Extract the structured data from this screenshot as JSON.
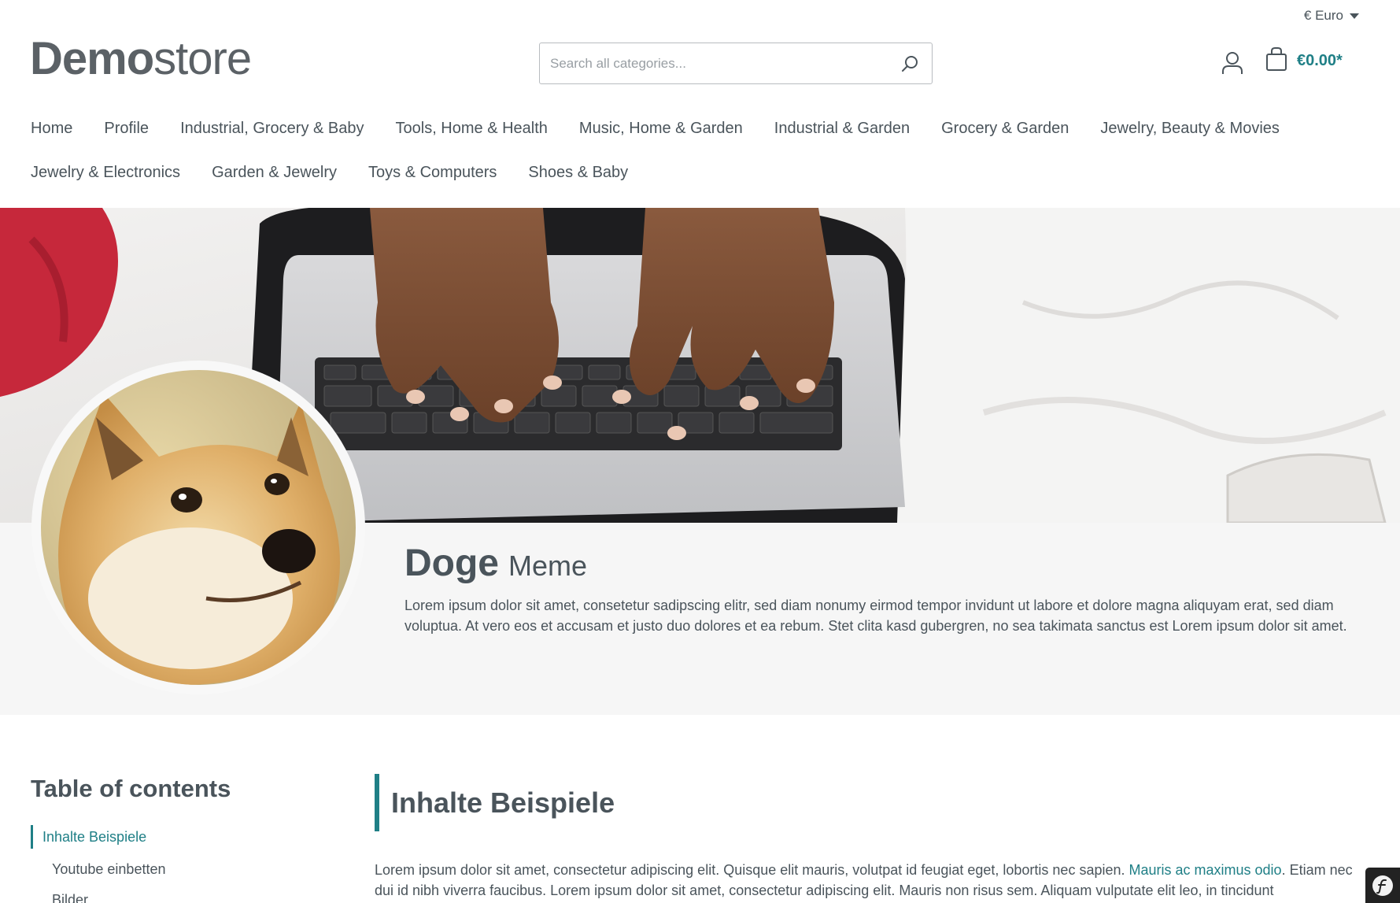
{
  "header": {
    "currency": "€ Euro",
    "logo_bold": "Demo",
    "logo_light": "store",
    "search_placeholder": "Search all categories...",
    "cart_total": "€0.00*"
  },
  "nav": {
    "items": [
      "Home",
      "Profile",
      "Industrial, Grocery & Baby",
      "Tools, Home & Health",
      "Music, Home & Garden",
      "Industrial & Garden",
      "Grocery & Garden",
      "Jewelry, Beauty & Movies",
      "Jewelry & Electronics",
      "Garden & Jewelry",
      "Toys & Computers",
      "Shoes & Baby"
    ]
  },
  "profile": {
    "first_name": "Doge",
    "last_name": "Meme",
    "description": "Lorem ipsum dolor sit amet, consetetur sadipscing elitr, sed diam nonumy eirmod tempor invidunt ut labore et dolore magna aliquyam erat, sed diam voluptua. At vero eos et accusam et justo duo dolores et ea rebum. Stet clita kasd gubergren, no sea takimata sanctus est Lorem ipsum dolor sit amet."
  },
  "toc": {
    "title": "Table of contents",
    "active_item": "Inhalte Beispiele",
    "sub_items": [
      "Youtube einbetten",
      "Bilder"
    ]
  },
  "content": {
    "heading": "Inhalte Beispiele",
    "text_before_link": "Lorem ipsum dolor sit amet, consectetur adipiscing elit. Quisque elit mauris, volutpat id feugiat eget, lobortis nec sapien. ",
    "link_text": "Mauris ac maximus odio",
    "text_after_link": ". Etiam nec dui id nibh viverra faucibus. Lorem ipsum dolor sit amet, consectetur adipiscing elit. Mauris non risus sem. Aliquam vulputate elit leo, in tincidunt"
  },
  "colors": {
    "accent": "#1f7f86",
    "text": "#4a545b",
    "band": "#f6f6f6"
  }
}
